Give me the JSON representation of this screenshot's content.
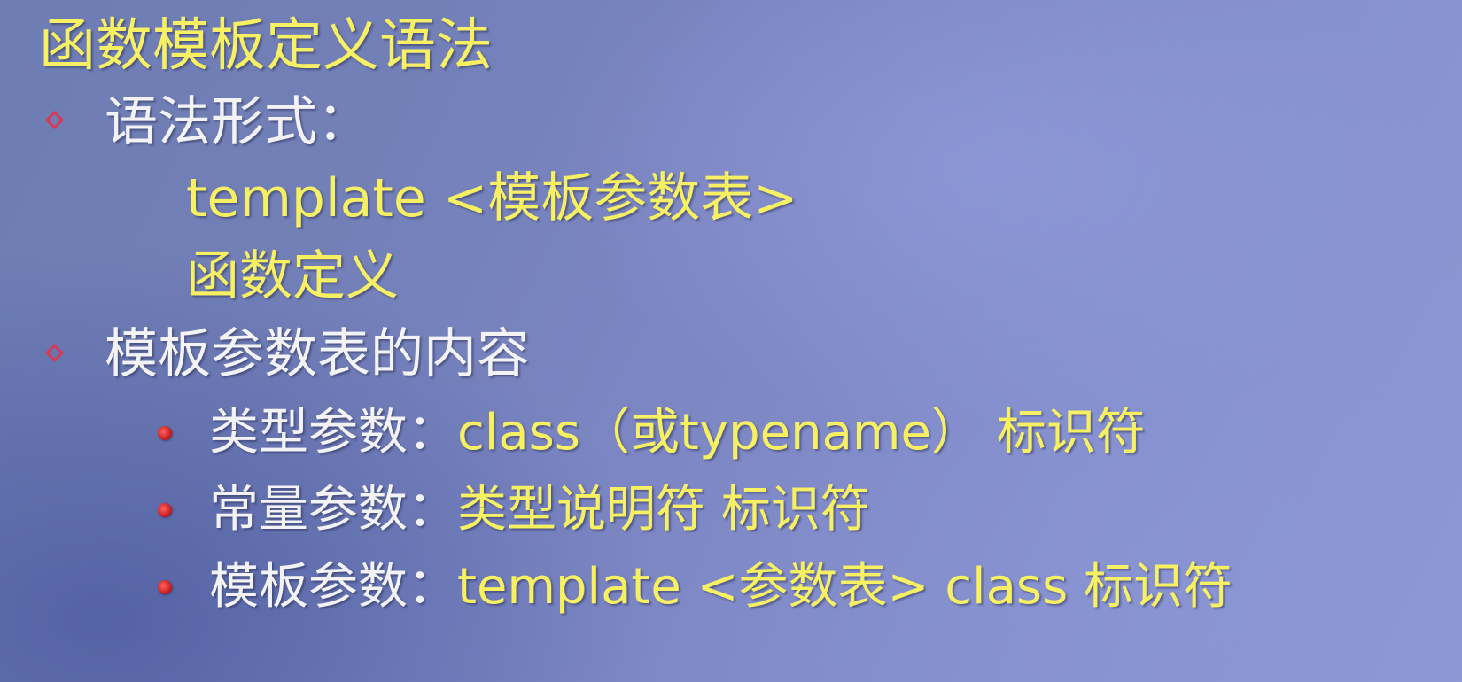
{
  "slide": {
    "title": "函数模板定义语法",
    "section1": {
      "label": "语法形式：",
      "code_line1": "template <模板参数表>",
      "code_line2": "函数定义"
    },
    "section2": {
      "label": "模板参数表的内容",
      "items": [
        {
          "term": "类型参数：",
          "desc": "class（或typename） 标识符"
        },
        {
          "term": "常量参数：",
          "desc": "类型说明符  标识符"
        },
        {
          "term": "模板参数：",
          "desc": "template <参数表> class 标识符"
        }
      ]
    }
  },
  "colors": {
    "heading_yellow": "#f6f062",
    "body_white": "#f3f3f6",
    "bullet_red": "#d23c55"
  }
}
